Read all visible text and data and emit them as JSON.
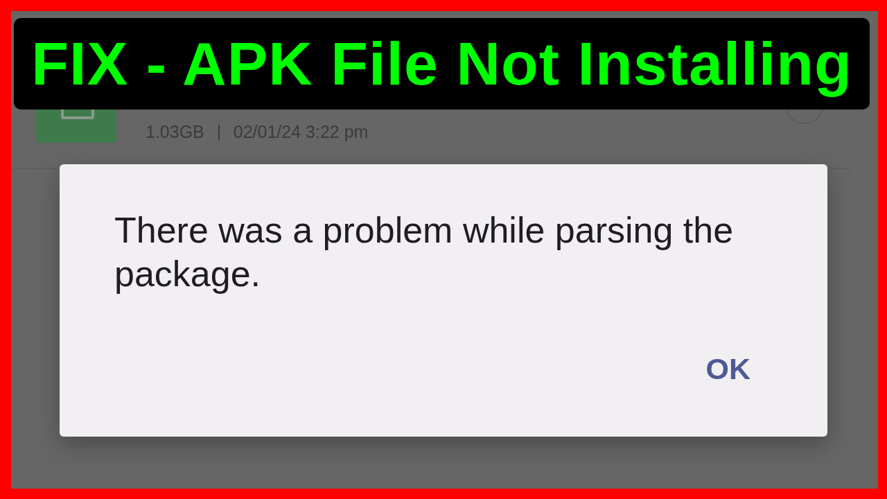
{
  "banner": {
    "title": "FIX - APK File Not Installing"
  },
  "file_row": {
    "meta": [
      "1.03GB",
      "02/01/24 3:22 pm"
    ],
    "checked": false
  },
  "dialog": {
    "message": "There was a problem while parsing the package.",
    "buttons": [
      "OK"
    ]
  }
}
